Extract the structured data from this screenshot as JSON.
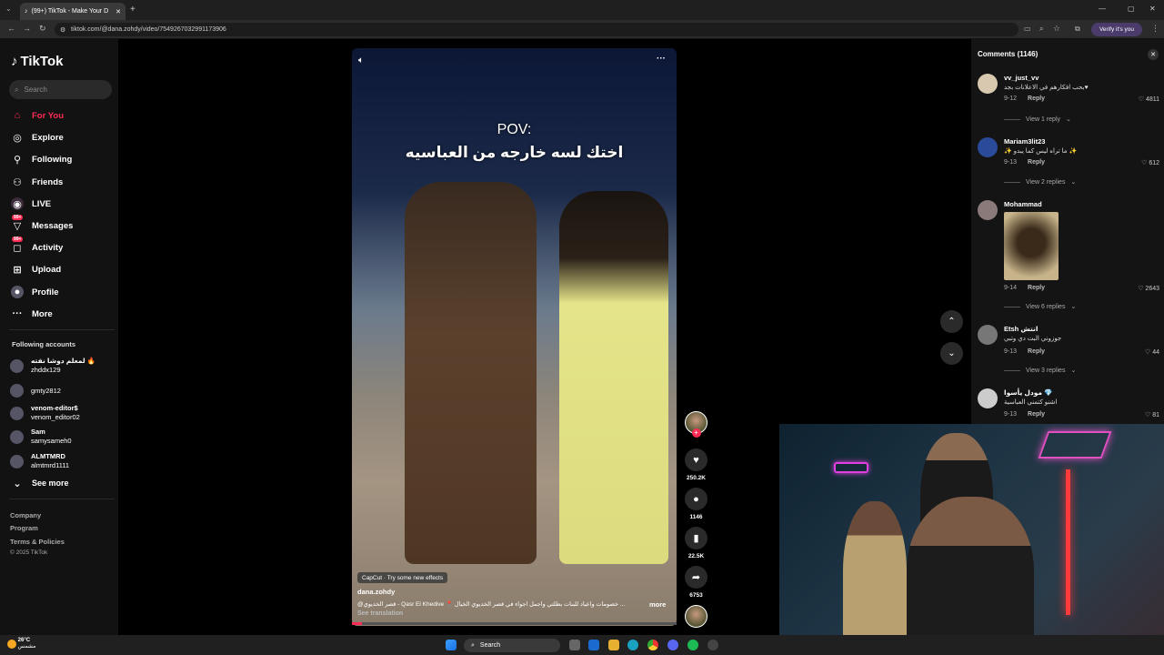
{
  "browser": {
    "tab_title": "(99+) TikTok - Make Your D",
    "url": "tiktok.com/@dana.zohdy/video/7549267032991173906",
    "verify_label": "Verify it's you"
  },
  "sidebar": {
    "logo": "TikTok",
    "search_placeholder": "Search",
    "nav": [
      {
        "label": "For You",
        "icon": "home-icon"
      },
      {
        "label": "Explore",
        "icon": "compass-icon"
      },
      {
        "label": "Following",
        "icon": "person-icon"
      },
      {
        "label": "Friends",
        "icon": "friends-icon"
      },
      {
        "label": "LIVE",
        "icon": "live-icon"
      },
      {
        "label": "Messages",
        "icon": "messages-icon",
        "badge": "99+"
      },
      {
        "label": "Activity",
        "icon": "activity-icon",
        "badge": "99+"
      },
      {
        "label": "Upload",
        "icon": "upload-icon"
      },
      {
        "label": "Profile",
        "icon": "profile-icon"
      },
      {
        "label": "More",
        "icon": "more-icon"
      }
    ],
    "following_header": "Following accounts",
    "accounts": [
      {
        "name": "لمعلم دوشا نفته 🔥",
        "handle": "zhddx129"
      },
      {
        "name": "gmty2812",
        "handle": ""
      },
      {
        "name": "venom-editor$",
        "handle": "venom_editor02"
      },
      {
        "name": "Sam",
        "handle": "samysameh0"
      },
      {
        "name": "ALMTMRD",
        "handle": "almtmrd1111"
      }
    ],
    "see_more": "See more",
    "footer": [
      "Company",
      "Program",
      "Terms & Policies",
      "© 2025 TikTok"
    ]
  },
  "video": {
    "overlay_title": "POV:",
    "overlay_arabic": "اختك لسه خارجه من العباسيه",
    "capcut": "CapCut · Try some new effects",
    "author": "dana.zohdy",
    "description": "@قصر الخديوي - Qasr El Khedive 📍 خصومات واعياد للبنات بطلتي واجمل اجواء في قصر الخديوي الخيال ...",
    "more": "more",
    "see_translation": "See translation",
    "progress": 0.03
  },
  "actions": {
    "likes": "250.2K",
    "comments": "1146",
    "saves": "22.5K",
    "shares": "6753"
  },
  "comments": {
    "title": "Comments (1146)",
    "items": [
      {
        "user": "vv_just_vv",
        "text": "بحب افكارهم في الاعلانات بجد♥",
        "date": "9-12",
        "reply": "Reply",
        "likes": "4811",
        "replies": "View 1 reply"
      },
      {
        "user": "Mariam3lit23",
        "text": "✨ ما تراه ليس كما يبدو ✨",
        "date": "9-13",
        "reply": "Reply",
        "likes": "612",
        "replies": "View 2 replies"
      },
      {
        "user": "Mohammad",
        "text": "",
        "date": "9-14",
        "reply": "Reply",
        "likes": "2643",
        "replies": "View 6 replies"
      },
      {
        "user": "Etsh انتش",
        "text": "جوزوني البت دي وتبي",
        "date": "9-13",
        "reply": "Reply",
        "likes": "44",
        "replies": "View 3 replies"
      },
      {
        "user": "مودل يأسوا 💎",
        "text": "اشنو كتمني العباسية",
        "date": "9-13",
        "reply": "Reply",
        "likes": "81",
        "replies": ""
      }
    ]
  },
  "taskbar": {
    "temp": "26°C",
    "weather": "مشمس",
    "search": "Search"
  },
  "colors": {
    "accent": "#fe2c55",
    "bg": "#000000",
    "panel": "#141414"
  }
}
